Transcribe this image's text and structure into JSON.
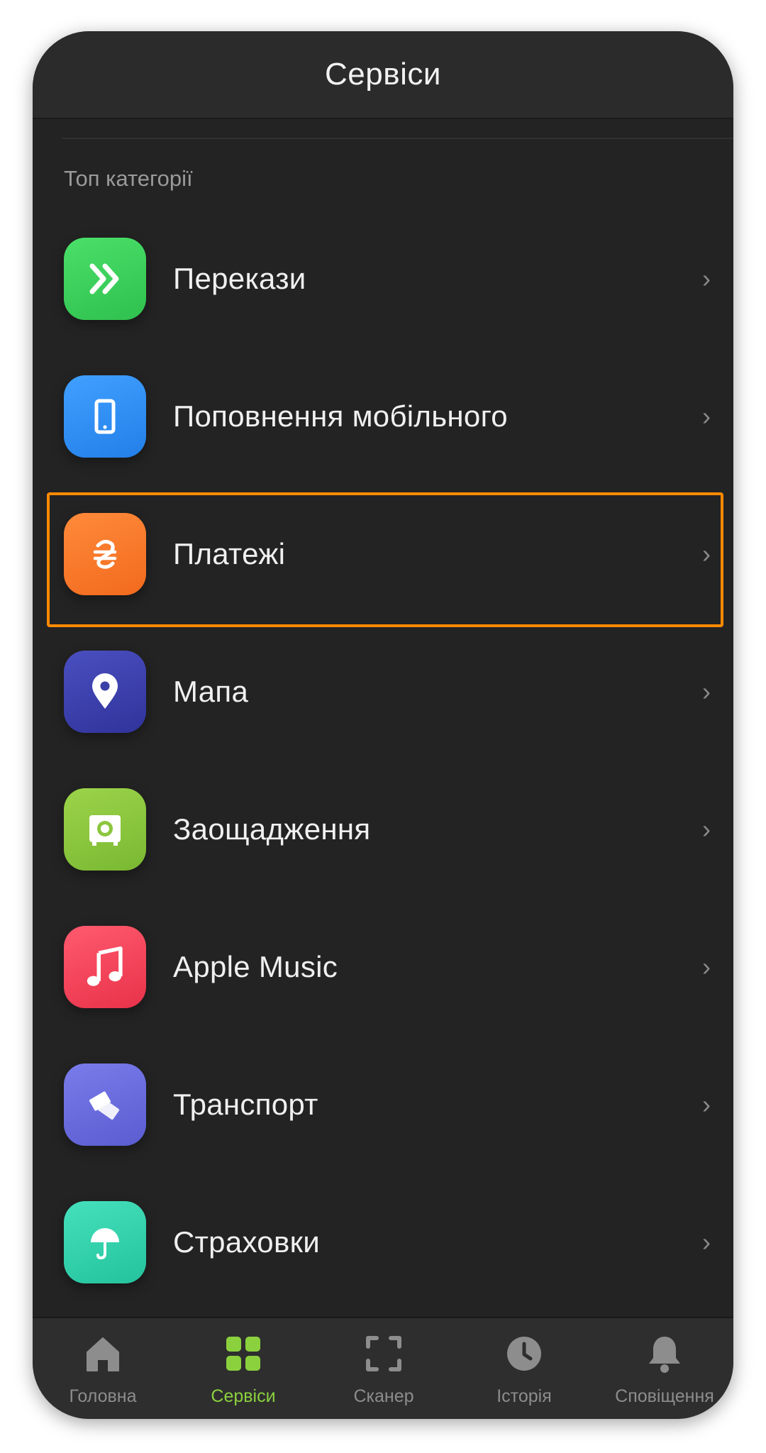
{
  "header": {
    "title": "Сервіси"
  },
  "section": {
    "title": "Топ категорії"
  },
  "items": [
    {
      "label": "Перекази",
      "icon": "transfer-chevrons-icon",
      "color": "#3fcf5a"
    },
    {
      "label": "Поповнення мобільного",
      "icon": "smartphone-icon",
      "color": "#2f8df5"
    },
    {
      "label": "Платежі",
      "icon": "hryvnia-icon",
      "color": "#ff7a2a"
    },
    {
      "label": "Мапа",
      "icon": "map-pin-icon",
      "color": "#3b3fa8"
    },
    {
      "label": "Заощадження",
      "icon": "safe-icon",
      "color": "#8cc63f"
    },
    {
      "label": "Apple Music",
      "icon": "music-note-icon",
      "color": "#f2445a"
    },
    {
      "label": "Транспорт",
      "icon": "tickets-icon",
      "color": "#6c6ee0"
    },
    {
      "label": "Страховки",
      "icon": "umbrella-icon",
      "color": "#35d6b0"
    }
  ],
  "highlight": {
    "color": "#ff8a00",
    "item_label": "Платежі"
  },
  "tabbar": {
    "active_color": "#8bd13e",
    "tabs": [
      {
        "label": "Головна",
        "icon": "home-icon",
        "active": false
      },
      {
        "label": "Сервіси",
        "icon": "grid-icon",
        "active": true
      },
      {
        "label": "Сканер",
        "icon": "scanner-frame-icon",
        "active": false
      },
      {
        "label": "Історія",
        "icon": "clock-icon",
        "active": false
      },
      {
        "label": "Сповіщення",
        "icon": "bell-icon",
        "active": false
      }
    ]
  }
}
